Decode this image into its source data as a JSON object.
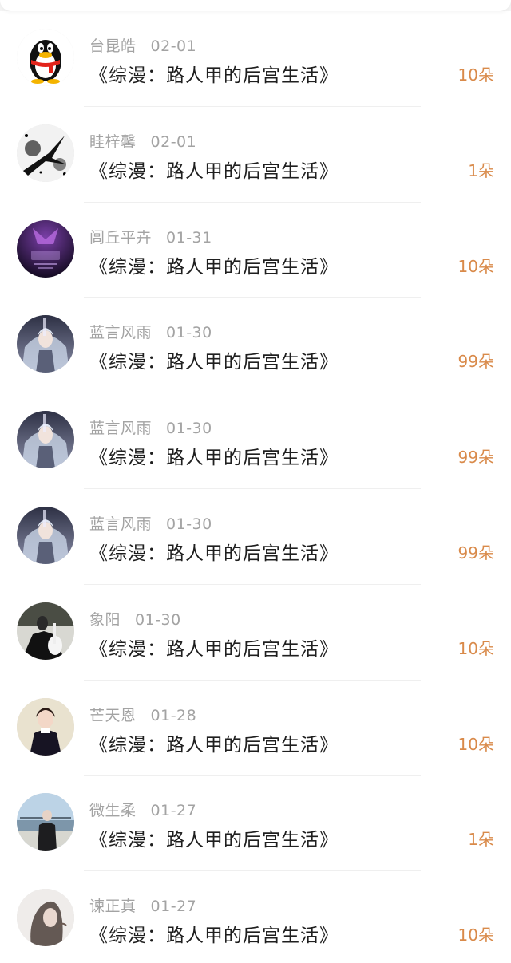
{
  "accent_color": "#d98a4a",
  "items": [
    {
      "name": "台昆皓",
      "date": "02-01",
      "title": "《综漫：路人甲的后宫生活》",
      "amount": "10朵",
      "avatar_icon": "penguin-icon"
    },
    {
      "name": "眭梓馨",
      "date": "02-01",
      "title": "《综漫：路人甲的后宫生活》",
      "amount": "1朵",
      "avatar_icon": "ink-swallow-icon"
    },
    {
      "name": "闾丘平卉",
      "date": "01-31",
      "title": "《综漫：路人甲的后宫生活》",
      "amount": "10朵",
      "avatar_icon": "gemini-poster-icon"
    },
    {
      "name": "蓝言风雨",
      "date": "01-30",
      "title": "《综漫：路人甲的后宫生活》",
      "amount": "99朵",
      "avatar_icon": "anime-girl-icon"
    },
    {
      "name": "蓝言风雨",
      "date": "01-30",
      "title": "《综漫：路人甲的后宫生活》",
      "amount": "99朵",
      "avatar_icon": "anime-girl-icon"
    },
    {
      "name": "蓝言风雨",
      "date": "01-30",
      "title": "《综漫：路人甲的后宫生活》",
      "amount": "99朵",
      "avatar_icon": "anime-girl-icon"
    },
    {
      "name": "象阳",
      "date": "01-30",
      "title": "《综漫：路人甲的后宫生活》",
      "amount": "10朵",
      "avatar_icon": "guitar-girl-icon"
    },
    {
      "name": "芒天恩",
      "date": "01-28",
      "title": "《综漫：路人甲的后宫生活》",
      "amount": "10朵",
      "avatar_icon": "girl-portrait-icon"
    },
    {
      "name": "微生柔",
      "date": "01-27",
      "title": "《综漫：路人甲的后宫生活》",
      "amount": "1朵",
      "avatar_icon": "seaside-person-icon"
    },
    {
      "name": "谏正真",
      "date": "01-27",
      "title": "《综漫：路人甲的后宫生活》",
      "amount": "10朵",
      "avatar_icon": "sketch-girl-icon"
    }
  ]
}
